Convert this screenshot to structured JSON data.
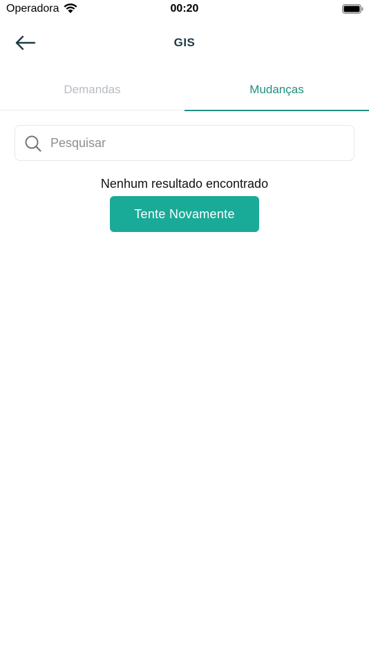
{
  "status_bar": {
    "carrier": "Operadora",
    "time": "00:20"
  },
  "nav": {
    "title": "GIS",
    "back_icon": "arrow-left-icon"
  },
  "tabs": [
    {
      "label": "Demandas",
      "active": false
    },
    {
      "label": "Mudanças",
      "active": true
    }
  ],
  "search": {
    "placeholder": "Pesquisar",
    "value": "",
    "icon": "search-icon"
  },
  "empty_state": {
    "message": "Nenhum resultado encontrado",
    "retry_label": "Tente Novamente"
  },
  "colors": {
    "accent": "#1f8f80",
    "button": "#1aaa98",
    "title": "#1f3a45",
    "inactive_tab": "#b7bcc2"
  }
}
